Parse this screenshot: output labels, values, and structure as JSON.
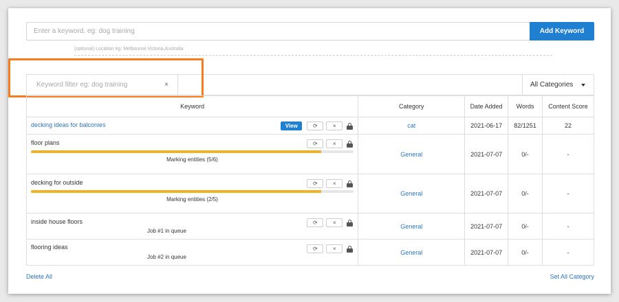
{
  "add_keyword": {
    "placeholder": "Enter a keyword, eg: dog training",
    "button_label": "Add Keyword",
    "location_hint": "(optional) Location eg: Melbourne,Victoria,Australia"
  },
  "filter": {
    "placeholder": "Keyword filter eg: dog training",
    "clear": "×",
    "category_select": "All Categories"
  },
  "table": {
    "headers": [
      "Keyword",
      "Category",
      "Date Added",
      "Words",
      "Content Score"
    ],
    "rows": [
      {
        "keyword": "decking ideas for balconies",
        "category": "cat",
        "date": "2021-06-17",
        "words": "82/1251",
        "score": "22",
        "view_label": "View"
      },
      {
        "keyword": "floor plans",
        "category": "General",
        "date": "2021-07-07",
        "words": "0/-",
        "score": "-",
        "status": "Marking entities (5/6)",
        "progress": 0.9
      },
      {
        "keyword": "decking for outside",
        "category": "General",
        "date": "2021-07-07",
        "words": "0/-",
        "score": "-",
        "status": "Marking entities (2/5)",
        "progress": 0.9
      },
      {
        "keyword": "inside house floors",
        "category": "General",
        "date": "2021-07-07",
        "words": "0/-",
        "score": "-",
        "status": "Job #1 in queue"
      },
      {
        "keyword": "flooring ideas",
        "category": "General",
        "date": "2021-07-07",
        "words": "0/-",
        "score": "-",
        "status": "Job #2 in queue"
      }
    ],
    "refresh_icon": "⟳",
    "remove_icon": "×"
  },
  "footer": {
    "delete_all": "Delete All",
    "set_all_category": "Set All Category"
  },
  "colors": {
    "accent": "#1f7fd0",
    "link": "#2d76b9",
    "progress": "#f0b323",
    "highlight": "#f57c1f"
  }
}
